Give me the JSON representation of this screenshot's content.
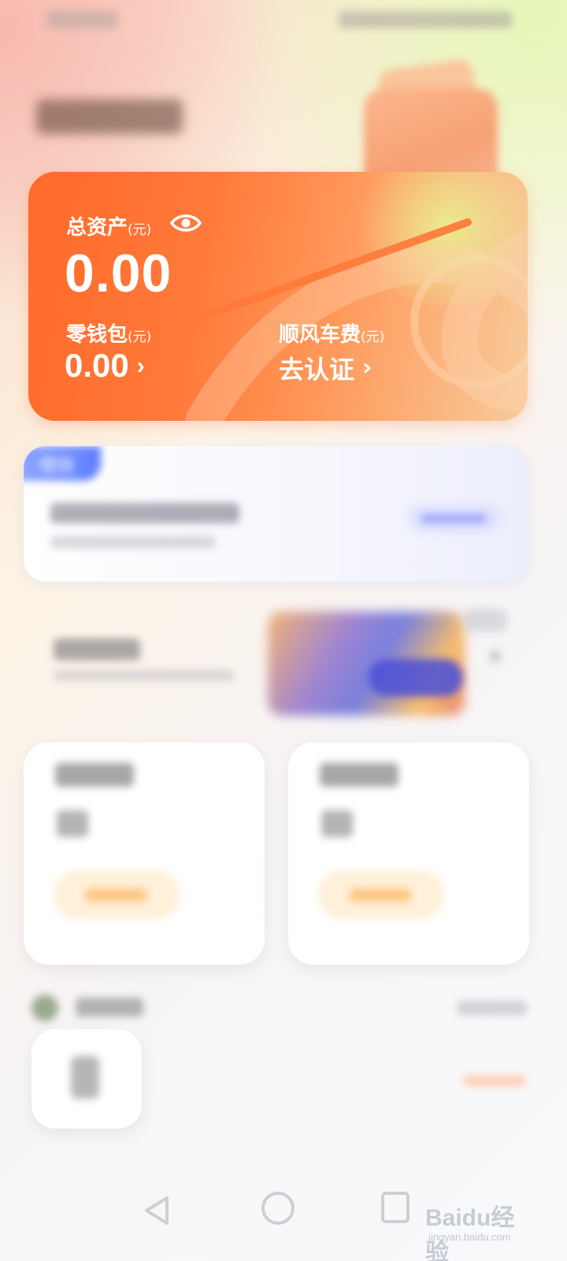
{
  "asset_card": {
    "total_assets_label": "总资产",
    "unit": "(元)",
    "total_value": "0.00",
    "wallet_label": "零钱包",
    "wallet_value": "0.00",
    "ride_fee_label": "顺风车费",
    "ride_fee_value": "去认证",
    "chevron": "›"
  },
  "loan": {
    "tag": "借钱"
  },
  "watermark": {
    "main": "Baidu经验",
    "sub": "jingyan.baidu.com"
  },
  "colors": {
    "card_start": "#ff6a2b",
    "card_end": "#f7cc9c",
    "annotation_arrow": "#ff7a3a",
    "loan_tag": "#5d7dff"
  },
  "icons": {
    "eye": "eye-icon",
    "back": "back-icon",
    "home": "home-icon",
    "recent": "recent-apps-icon"
  }
}
